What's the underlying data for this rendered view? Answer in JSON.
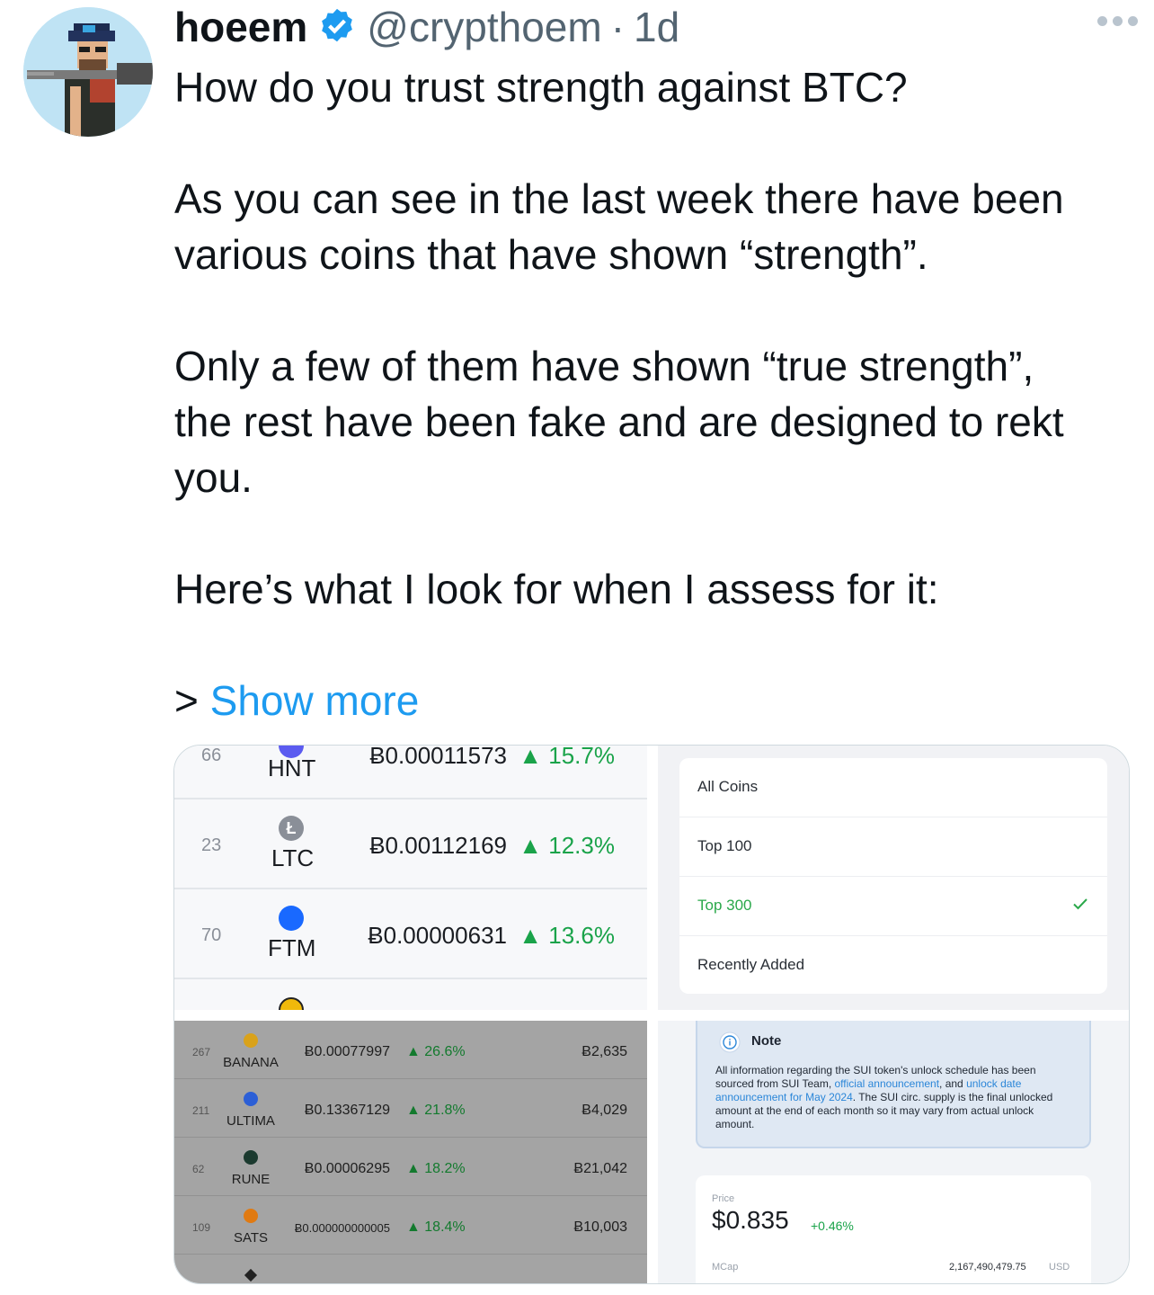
{
  "author": {
    "name": "hoeem",
    "handle": "@crypthoem",
    "separator": "·",
    "time": "1d",
    "avatar_icon": "pixel-art-character-avatar",
    "verified_icon": "verified-badge-icon"
  },
  "tweet": {
    "line1": "How do you trust strength against BTC?",
    "line2": "As you can see in the last week there have been",
    "line3": "various coins that have shown “strength”.",
    "line4": "Only a few of them have shown “true strength”,",
    "line5": "the rest have been fake and are designed to rekt",
    "line6": "you.",
    "line7": "Here’s what I look for when I assess for it:",
    "show_more_prefix": ">",
    "show_more": "Show more"
  },
  "media": {
    "panel1": {
      "rows": [
        {
          "rank": "66",
          "symbol": "HNT",
          "price": "Ƀ0.00011573",
          "change": "15.7%",
          "color": "#5b5bf0"
        },
        {
          "rank": "23",
          "symbol": "LTC",
          "price": "Ƀ0.00112169",
          "change": "12.3%",
          "color": "#8a8f98"
        },
        {
          "rank": "70",
          "symbol": "FTM",
          "price": "Ƀ0.00000631",
          "change": "13.6%",
          "color": "#1969ff"
        }
      ]
    },
    "panel2": {
      "items": [
        "All Coins",
        "Top 100",
        "Top 300",
        "Recently Added"
      ],
      "selected": "Top 300"
    },
    "panel3": {
      "rows": [
        {
          "rank": "267",
          "symbol": "BANANA",
          "price": "Ƀ0.00077997",
          "change": "26.6%",
          "volume": "Ƀ2,635",
          "color": "#d9a21b"
        },
        {
          "rank": "211",
          "symbol": "ULTIMA",
          "price": "Ƀ0.13367129",
          "change": "21.8%",
          "volume": "Ƀ4,029",
          "color": "#2c5fd6"
        },
        {
          "rank": "62",
          "symbol": "RUNE",
          "price": "Ƀ0.00006295",
          "change": "18.2%",
          "volume": "Ƀ21,042",
          "color": "#1b3a2f"
        },
        {
          "rank": "109",
          "symbol": "SATS",
          "price": "Ƀ0.000000000005",
          "change": "18.4%",
          "volume": "Ƀ10,003",
          "color": "#e07a12"
        }
      ]
    },
    "panel4": {
      "note_title": "Note",
      "note_text_1": "All information regarding the SUI token's unlock schedule has been sourced from SUI Team, ",
      "note_link_1": "official announcement",
      "note_text_2": ", and ",
      "note_link_2": "unlock date announcement for May 2024",
      "note_text_3": ". The SUI circ. supply is the final unlocked amount at the end of each month so it may vary from actual unlock amount.",
      "price_label": "Price",
      "price": "$0.835",
      "price_change": "+0.46%",
      "mcap_label": "MCap",
      "mcap_value": "2,167,490,479.75",
      "mcap_unit": "USD"
    }
  }
}
